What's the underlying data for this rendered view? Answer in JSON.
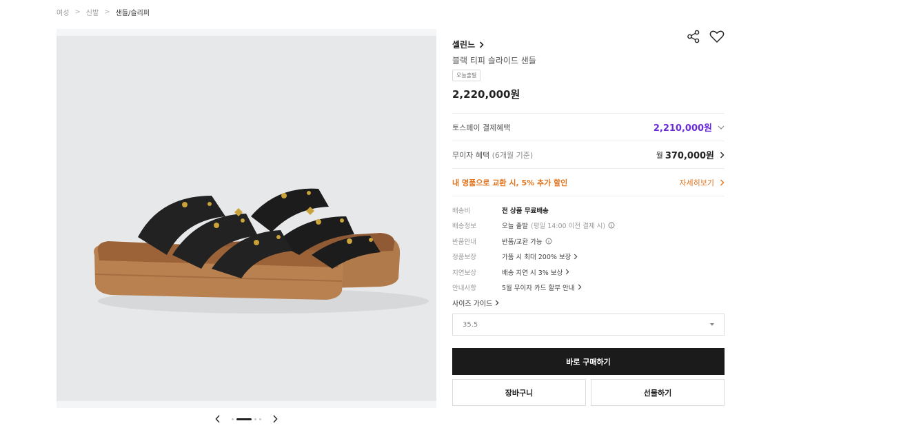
{
  "breadcrumb": {
    "items": [
      "여성",
      "신발",
      "샌들/슬리퍼"
    ],
    "separator": ">"
  },
  "gallery": {
    "image_alt": "블랙 티피 슬라이드 샌들",
    "dots_total": 4,
    "active_dot": 1
  },
  "product": {
    "brand": "셀린느",
    "name": "블랙 티피 슬라이드 샌들",
    "badge": "오늘출발",
    "price": "2,220,000원"
  },
  "rows": {
    "toss": {
      "label": "토스페이 결제혜택",
      "value": "2,210,000원"
    },
    "installment": {
      "label": "무이자 혜택",
      "label_sub": "(6개월 기준)",
      "value_prefix": "월",
      "value": "370,000원"
    },
    "promo": {
      "label": "내 명품으로 교환 시, 5% 추가 할인",
      "value": "자세히보기"
    }
  },
  "details": [
    {
      "key": "배송비",
      "value": "전 상품 무료배송",
      "sub": "",
      "icon": "",
      "bold": true
    },
    {
      "key": "배송정보",
      "value": "오늘 출발",
      "sub": "(평일 14:00 이전 결제 시)",
      "icon": "info-icon",
      "bold": false
    },
    {
      "key": "반품안내",
      "value": "반품/교환 가능",
      "sub": "",
      "icon": "info-icon",
      "bold": false
    },
    {
      "key": "정품보장",
      "value": "가품 시 최대 200% 보장",
      "sub": "",
      "icon": "chevron-right-icon",
      "bold": false
    },
    {
      "key": "지연보상",
      "value": "배송 지연 시 3% 보상",
      "sub": "",
      "icon": "chevron-right-icon",
      "bold": false
    },
    {
      "key": "안내사항",
      "value": "5월 무이자 카드 할부 안내",
      "sub": "",
      "icon": "chevron-right-icon",
      "bold": false
    }
  ],
  "size_guide": "사이즈 가이드",
  "size_select": {
    "selected": "35.5"
  },
  "buttons": {
    "buy_now": "바로 구매하기",
    "cart": "장바구니",
    "gift": "선물하기"
  },
  "colors": {
    "toss_accent": "#6b2bd9",
    "promo_accent": "#e2731c",
    "primary_button": "#1b1b1b"
  }
}
